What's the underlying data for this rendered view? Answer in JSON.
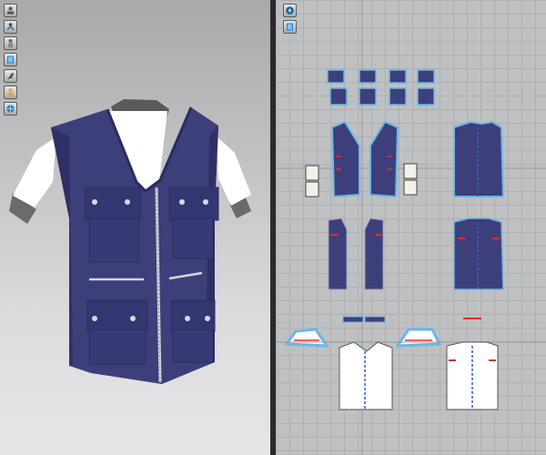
{
  "app": {
    "left_panel": "3d-garment-view",
    "right_panel": "2d-pattern-view"
  },
  "colors": {
    "garment_navy": "#3d3f7a",
    "garment_navy_dark": "#2f3166",
    "shirt_white": "#ffffff",
    "zipper_silver": "#d6d6de",
    "pattern_outline_blue": "#6ab7e8",
    "pattern_notch_red": "#e0302a",
    "grid_bg": "#bfc0c2"
  },
  "toolbar_3d": [
    {
      "icon": "avatar-view-icon"
    },
    {
      "icon": "avatar-pose-icon"
    },
    {
      "icon": "avatar-body-icon"
    },
    {
      "icon": "garment-view-icon"
    },
    {
      "icon": "brush-icon"
    },
    {
      "icon": "skin-icon"
    },
    {
      "icon": "globe-icon"
    }
  ],
  "toolbar_2d": [
    {
      "icon": "pattern-view-icon"
    },
    {
      "icon": "layer-view-icon"
    }
  ]
}
